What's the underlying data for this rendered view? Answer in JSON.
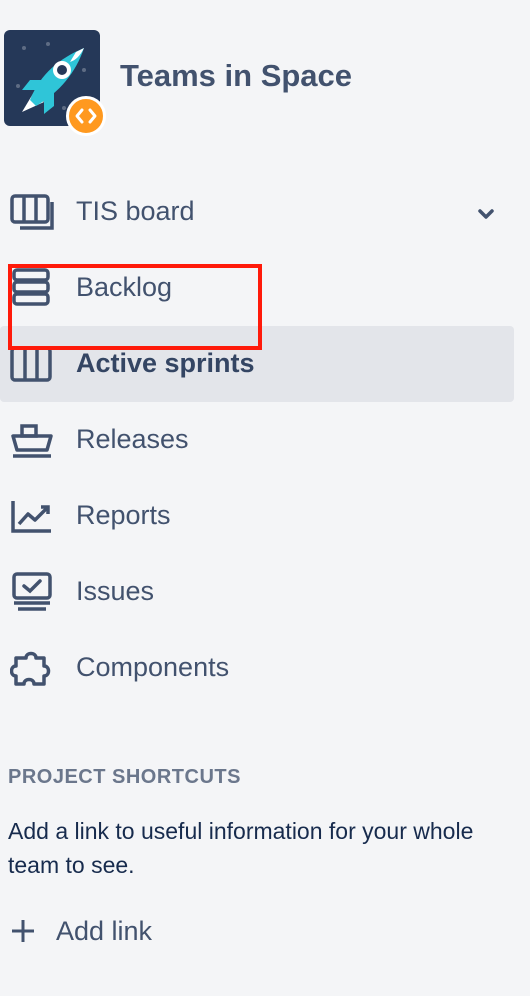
{
  "project": {
    "title": "Teams in Space",
    "avatar_icon": "rocket-icon",
    "badge_icon": "code-icon",
    "badge_color": "#ff991f",
    "avatar_bg": "#253858"
  },
  "nav": {
    "items": [
      {
        "label": "TIS board",
        "icon": "board-icon",
        "has_dropdown": true
      },
      {
        "label": "Backlog",
        "icon": "backlog-icon",
        "highlighted": true
      },
      {
        "label": "Active sprints",
        "icon": "sprint-icon",
        "active": true
      },
      {
        "label": "Releases",
        "icon": "ship-icon"
      },
      {
        "label": "Reports",
        "icon": "chart-icon"
      },
      {
        "label": "Issues",
        "icon": "issues-icon"
      },
      {
        "label": "Components",
        "icon": "puzzle-icon"
      }
    ]
  },
  "shortcuts": {
    "title": "PROJECT SHORTCUTS",
    "description": "Add a link to useful information for your whole team to see.",
    "add_label": "Add link"
  },
  "colors": {
    "highlight": "#ff1a0a",
    "active_bg": "#e3e5ea",
    "text": "#42526e"
  }
}
